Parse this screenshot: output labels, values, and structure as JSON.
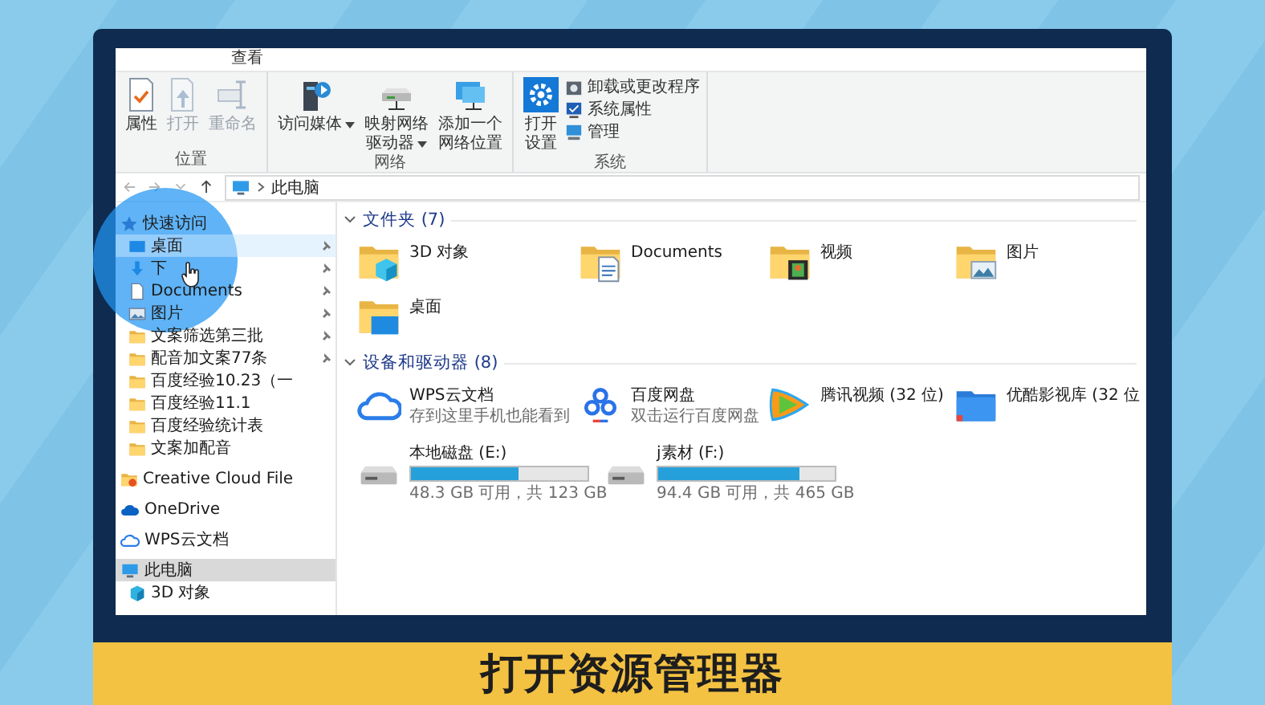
{
  "tabs": [
    {
      "label": "查看",
      "selected": false
    }
  ],
  "ribbon": {
    "groups": [
      {
        "label": "位置",
        "buttons": [
          {
            "kind": "properties",
            "lines": [
              "属性"
            ],
            "disabled": false,
            "dropdown": false
          },
          {
            "kind": "open",
            "lines": [
              "打开"
            ],
            "disabled": true,
            "dropdown": false
          },
          {
            "kind": "rename",
            "lines": [
              "重命名"
            ],
            "disabled": true,
            "dropdown": false
          }
        ]
      },
      {
        "label": "网络",
        "buttons": [
          {
            "kind": "media",
            "lines": [
              "访问媒体"
            ],
            "disabled": false,
            "dropdown": true
          },
          {
            "kind": "map-drive",
            "lines": [
              "映射网络",
              "驱动器"
            ],
            "disabled": false,
            "dropdown": true
          },
          {
            "kind": "add-location",
            "lines": [
              "添加一个",
              "网络位置"
            ],
            "disabled": false,
            "dropdown": false
          }
        ]
      },
      {
        "label": "系统",
        "buttons": [
          {
            "kind": "settings",
            "lines": [
              "打开",
              "设置"
            ],
            "disabled": false,
            "dropdown": false
          }
        ],
        "small_buttons": [
          {
            "kind": "uninstall",
            "label": "卸载或更改程序"
          },
          {
            "kind": "system-properties",
            "label": "系统属性"
          },
          {
            "kind": "manage",
            "label": "管理"
          }
        ]
      }
    ]
  },
  "address": {
    "path": "此电脑"
  },
  "nav": {
    "items": [
      {
        "kind": "star",
        "label": "快速访问",
        "pinned": false,
        "selected": false,
        "hovered": false,
        "children": [
          {
            "kind": "desktop",
            "label": "桌面",
            "pinned": true,
            "selected": false,
            "hovered": true
          },
          {
            "kind": "download",
            "label": "下",
            "pinned": true,
            "selected": false,
            "hovered": false
          },
          {
            "kind": "document",
            "label": "Documents",
            "pinned": true,
            "selected": false,
            "hovered": false
          },
          {
            "kind": "picture",
            "label": "图片",
            "pinned": true,
            "selected": false,
            "hovered": false
          },
          {
            "kind": "folder",
            "label": "文案筛选第三批",
            "pinned": true,
            "selected": false,
            "hovered": false
          },
          {
            "kind": "folder",
            "label": "配音加文案77条",
            "pinned": true,
            "selected": false,
            "hovered": false
          },
          {
            "kind": "folder",
            "label": "百度经验10.23（一",
            "pinned": false,
            "selected": false,
            "hovered": false
          },
          {
            "kind": "folder",
            "label": "百度经验11.1",
            "pinned": false,
            "selected": false,
            "hovered": false
          },
          {
            "kind": "folder",
            "label": "百度经验统计表",
            "pinned": false,
            "selected": false,
            "hovered": false
          },
          {
            "kind": "folder",
            "label": "文案加配音",
            "pinned": false,
            "selected": false,
            "hovered": false
          }
        ]
      },
      {
        "kind": "creative-cloud",
        "label": "Creative Cloud File",
        "pinned": false,
        "selected": false,
        "hovered": false
      },
      {
        "kind": "onedrive",
        "label": "OneDrive",
        "pinned": false,
        "selected": false,
        "hovered": false
      },
      {
        "kind": "wps",
        "label": "WPS云文档",
        "pinned": false,
        "selected": false,
        "hovered": false
      },
      {
        "kind": "pc",
        "label": "此电脑",
        "pinned": false,
        "selected": true,
        "hovered": false,
        "children": [
          {
            "kind": "cube",
            "label": "3D 对象",
            "pinned": false,
            "selected": false,
            "hovered": false
          }
        ]
      }
    ]
  },
  "sections": [
    {
      "title": "文件夹 (7)",
      "expanded": true,
      "items": [
        {
          "kind": "cube-folder",
          "name": "3D 对象"
        },
        {
          "kind": "document-folder",
          "name": "Documents"
        },
        {
          "kind": "video-folder",
          "name": "视频"
        },
        {
          "kind": "picture-folder",
          "name": "图片"
        },
        {
          "kind": "desktop-folder",
          "name": "桌面"
        }
      ]
    },
    {
      "title": "设备和驱动器 (8)",
      "expanded": true,
      "items": [
        {
          "kind": "wps",
          "name": "WPS云文档",
          "subtitle": "存到这里手机也能看到"
        },
        {
          "kind": "baidu",
          "name": "百度网盘",
          "subtitle": "双击运行百度网盘"
        },
        {
          "kind": "tencent",
          "name": "腾讯视频 (32 位)"
        },
        {
          "kind": "youku",
          "name": "优酷影视库 (32 位"
        },
        {
          "kind": "drive",
          "name": "本地磁盘 (E:)",
          "level": 0.61,
          "space": "48.3 GB 可用，共 123 GB"
        },
        {
          "kind": "drive",
          "name": "j素材 (F:)",
          "level": 0.8,
          "space": "94.4 GB 可用，共 465 GB"
        }
      ]
    }
  ],
  "caption": "打开资源管理器"
}
